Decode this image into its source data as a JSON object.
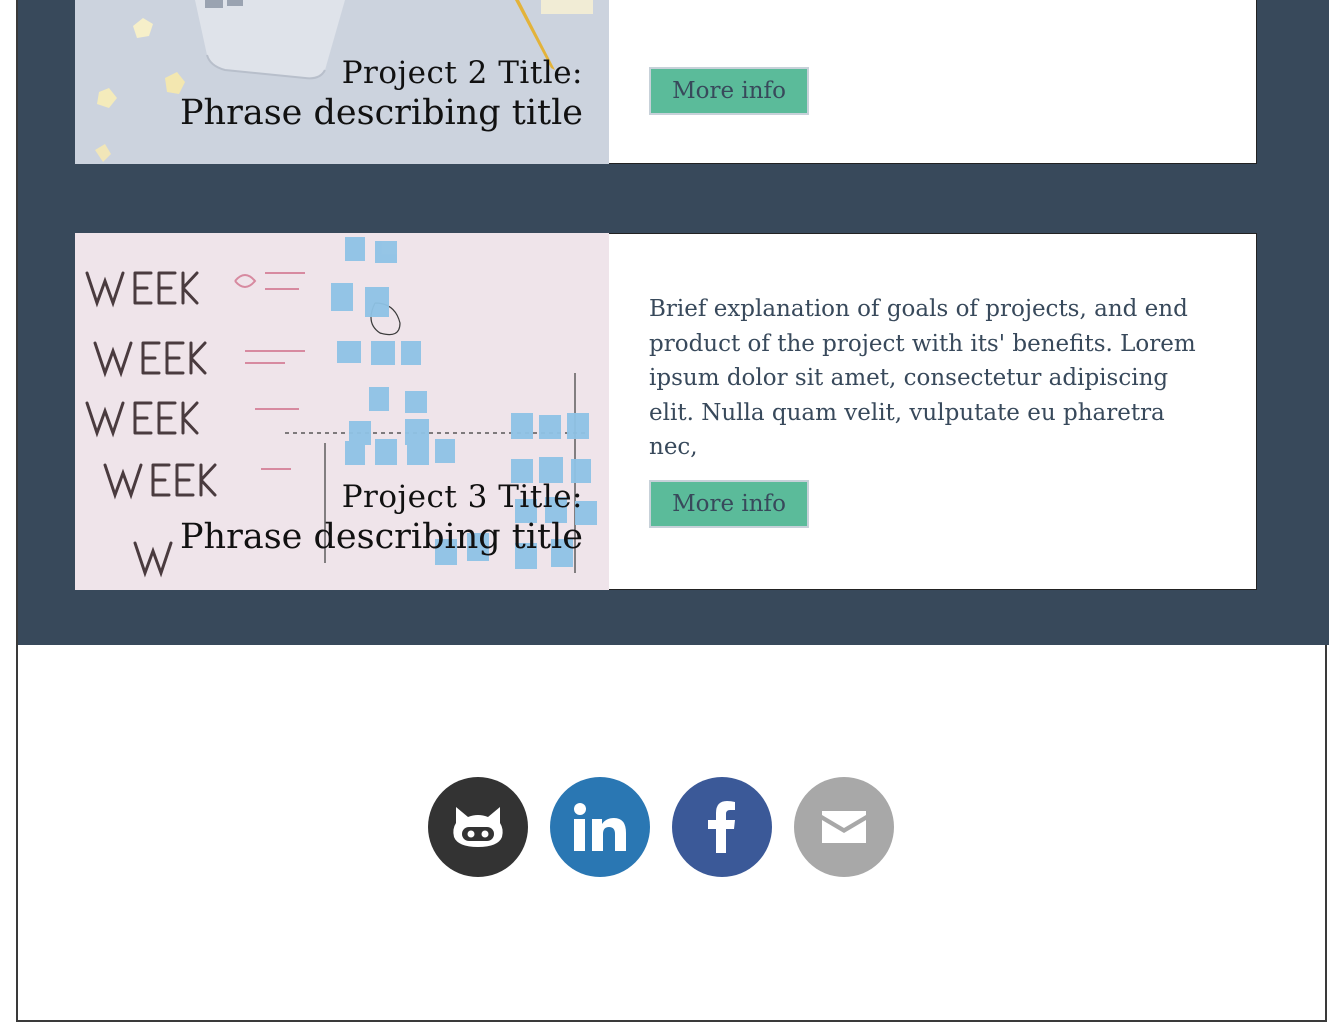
{
  "projects": [
    {
      "title_line1": "Project 2 Title:",
      "title_line2": "Phrase describing title",
      "more_label": "More info"
    },
    {
      "title_line1": "Project 3 Title:",
      "title_line2": "Phrase describing title",
      "description": "Brief explanation of goals of projects, and end product of the project with its' benefits. Lorem ipsum dolor sit amet, consectetur adipiscing elit. Nulla quam velit, vulputate eu pharetra nec,",
      "more_label": "More info"
    }
  ],
  "social": [
    {
      "name": "github",
      "icon": "github-icon",
      "color": "#333333"
    },
    {
      "name": "linkedin",
      "icon": "linkedin-icon",
      "color": "#2a77b3"
    },
    {
      "name": "facebook",
      "icon": "facebook-icon",
      "color": "#3b5998"
    },
    {
      "name": "email",
      "icon": "mail-icon",
      "color": "#a8a8a8"
    }
  ],
  "colors": {
    "section_bg": "#38495b",
    "button_bg": "#5bbb9a",
    "text": "#38495b"
  }
}
